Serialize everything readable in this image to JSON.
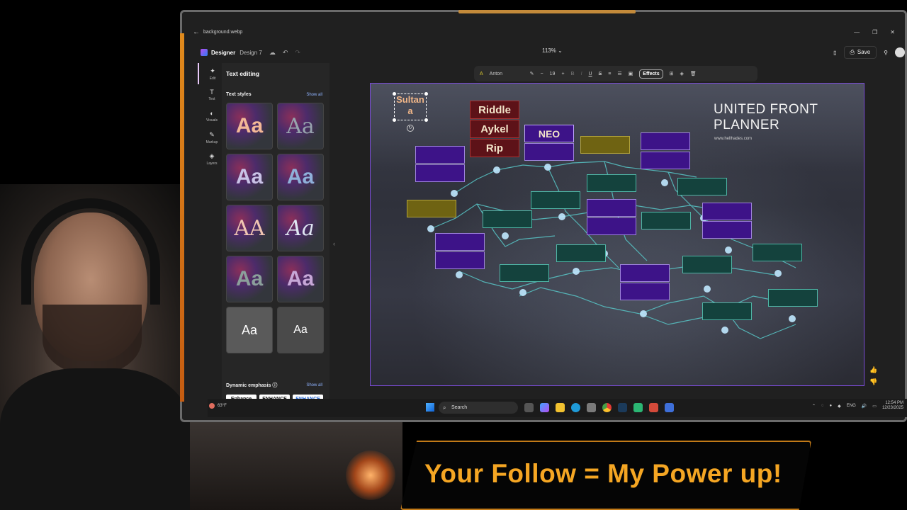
{
  "window": {
    "filename": "background.webp"
  },
  "app": {
    "name": "Designer",
    "design": "Design 7",
    "zoom": "113%",
    "save_label": "Save"
  },
  "rail": [
    {
      "label": "Edit"
    },
    {
      "label": "Text"
    },
    {
      "label": "Visuals"
    },
    {
      "label": "Markup"
    },
    {
      "label": "Layers"
    }
  ],
  "panel": {
    "title": "Text editing",
    "styles_label": "Text styles",
    "show_all": "Show all",
    "tile_text": "Aa",
    "tile_text_caps": "AA",
    "dynamic_label": "Dynamic emphasis",
    "dynamic_show_all": "Show all",
    "dynamic_chips": [
      "Enhance",
      "ENHANCE all your",
      "ENHANCE"
    ]
  },
  "toolbar": {
    "font": "Anton",
    "size": "19",
    "effects_label": "Effects"
  },
  "canvas": {
    "title": "UNITED FRONT PLANNER",
    "url": "www.hellhades.com",
    "selected_text": "Sultan a",
    "names": [
      "Riddle",
      "Aykel",
      "Rip"
    ],
    "neo": "NEO"
  },
  "taskbar": {
    "weather": "63°F",
    "search_placeholder": "Search",
    "lang": "ENG",
    "time": "12:54 PM",
    "date": "12/23/2025"
  },
  "banner": {
    "text": "Your Follow = My Power up!"
  },
  "colors": {
    "accent_orange": "#f5a623",
    "canvas_border": "#7a4bd6",
    "purple_box": "#3d1388",
    "teal_box": "#14423d",
    "olive_box": "#6f6312"
  }
}
